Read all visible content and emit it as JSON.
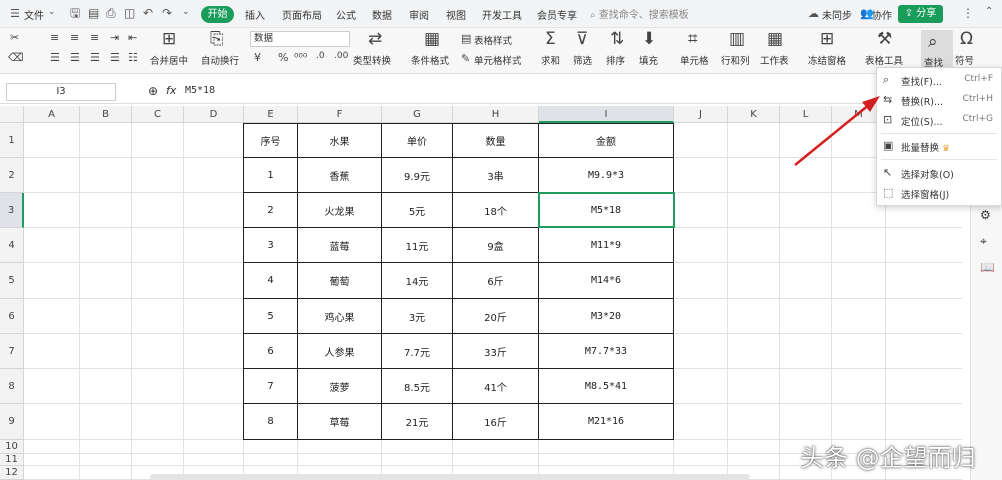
{
  "menubar": {
    "file_label": "文件",
    "tabs": [
      "开始",
      "插入",
      "页面布局",
      "公式",
      "数据",
      "审阅",
      "视图",
      "开发工具",
      "会员专享"
    ],
    "search_placeholder": "查找命令、搜索模板",
    "sync_label": "未同步",
    "collab_label": "协作",
    "share_label": "分享"
  },
  "ribbon": {
    "font_name": "数据",
    "labels": {
      "merge": "合并居中",
      "wrap": "自动换行",
      "convert": "类型转换",
      "cond_format": "条件格式",
      "table_style": "表格样式",
      "cell_style": "单元格样式",
      "sum": "求和",
      "filter": "筛选",
      "sort": "排序",
      "fill": "填充",
      "cell": "单元格",
      "rowcol": "行和列",
      "worksheet": "工作表",
      "freeze": "冻结窗格",
      "table_tools": "表格工具",
      "find": "查找",
      "symbol": "符号"
    }
  },
  "formula_bar": {
    "cell_ref": "I3",
    "fx": "fx",
    "value": "M5*18"
  },
  "sheet": {
    "columns": [
      "A",
      "B",
      "C",
      "D",
      "E",
      "F",
      "G",
      "H",
      "I",
      "J",
      "K",
      "L",
      "M"
    ],
    "row_numbers": [
      "1",
      "2",
      "3",
      "4",
      "5",
      "6",
      "7",
      "8",
      "9",
      "10",
      "11",
      "12"
    ],
    "headers": [
      "序号",
      "水果",
      "单价",
      "数量",
      "金额"
    ],
    "rows": [
      [
        "1",
        "香蕉",
        "9.9元",
        "3串",
        "M9.9*3"
      ],
      [
        "2",
        "火龙果",
        "5元",
        "18个",
        "M5*18"
      ],
      [
        "3",
        "蓝莓",
        "11元",
        "9盒",
        "M11*9"
      ],
      [
        "4",
        "葡萄",
        "14元",
        "6斤",
        "M14*6"
      ],
      [
        "5",
        "鸡心果",
        "3元",
        "20斤",
        "M3*20"
      ],
      [
        "6",
        "人参果",
        "7.7元",
        "33斤",
        "M7.7*33"
      ],
      [
        "7",
        "菠萝",
        "8.5元",
        "41个",
        "M8.5*41"
      ],
      [
        "8",
        "草莓",
        "21元",
        "16斤",
        "M21*16"
      ]
    ]
  },
  "dropdown": {
    "items": [
      {
        "label": "查找(F)...",
        "shortcut": "Ctrl+F",
        "icon": "search-icon"
      },
      {
        "label": "替换(R)...",
        "shortcut": "Ctrl+H",
        "icon": "replace-icon"
      },
      {
        "label": "定位(S)...",
        "shortcut": "Ctrl+G",
        "icon": "locate-icon"
      },
      {
        "label": "批量替换",
        "shortcut": "",
        "icon": "batch-replace-icon"
      },
      {
        "label": "选择对象(O)",
        "shortcut": "",
        "icon": "cursor-icon"
      },
      {
        "label": "选择窗格(J)",
        "shortcut": "",
        "icon": "pane-icon"
      }
    ]
  },
  "watermark": "头条 @企望而归",
  "colors": {
    "accent": "#1a9c5b",
    "selection": "#1e9c5f",
    "arrow": "#d42020"
  }
}
